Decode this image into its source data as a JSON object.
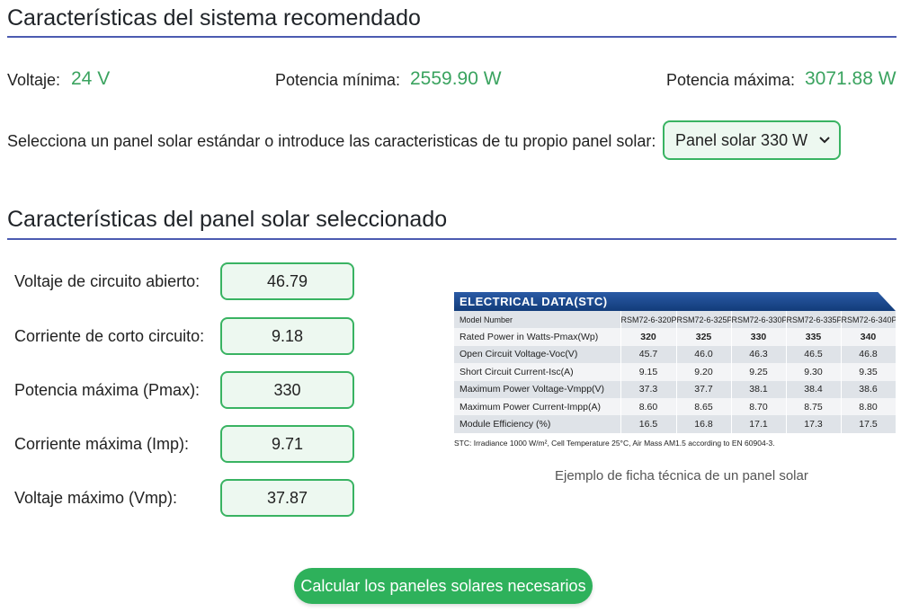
{
  "recommended": {
    "title": "Características del sistema recomendado",
    "voltage_label": "Voltaje:",
    "voltage_value": "24 V",
    "pmin_label": "Potencia mínima:",
    "pmin_value": "2559.90 W",
    "pmax_label": "Potencia máxima:",
    "pmax_value": "3071.88 W"
  },
  "panel_select": {
    "prompt": "Selecciona un panel solar estándar o introduce las caracteristicas de tu propio panel solar:",
    "selected": "Panel solar 330 W"
  },
  "selected_panel": {
    "title": "Características del panel solar seleccionado",
    "fields": [
      {
        "label": "Voltaje de circuito abierto:",
        "value": "46.79"
      },
      {
        "label": "Corriente de corto circuito:",
        "value": "9.18"
      },
      {
        "label": "Potencia máxima (Pmax):",
        "value": "330"
      },
      {
        "label": "Corriente máxima (Imp):",
        "value": "9.71"
      },
      {
        "label": "Voltaje máximo (Vmp):",
        "value": "37.87"
      }
    ]
  },
  "datasheet": {
    "header": "ELECTRICAL DATA(STC)",
    "rows": [
      [
        "Model Number",
        "RSM72-6-320P",
        "RSM72-6-325P",
        "RSM72-6-330P",
        "RSM72-6-335P",
        "RSM72-6-340P"
      ],
      [
        "Rated Power in Watts-Pmax(Wp)",
        "320",
        "325",
        "330",
        "335",
        "340"
      ],
      [
        "Open Circuit Voltage-Voc(V)",
        "45.7",
        "46.0",
        "46.3",
        "46.5",
        "46.8"
      ],
      [
        "Short Circuit Current-Isc(A)",
        "9.15",
        "9.20",
        "9.25",
        "9.30",
        "9.35"
      ],
      [
        "Maximum Power Voltage-Vmpp(V)",
        "37.3",
        "37.7",
        "38.1",
        "38.4",
        "38.6"
      ],
      [
        "Maximum Power Current-Impp(A)",
        "8.60",
        "8.65",
        "8.70",
        "8.75",
        "8.80"
      ],
      [
        "Module Efficiency (%)",
        "16.5",
        "16.8",
        "17.1",
        "17.3",
        "17.5"
      ]
    ],
    "note": "STC: Irradiance 1000 W/m², Cell Temperature 25°C, Air Mass AM1.5 according to EN 60904-3.",
    "caption": "Ejemplo de ficha técnica de un panel solar"
  },
  "calc_button": "Calcular los paneles solares necesarios",
  "colors": {
    "accent": "#39b362",
    "value": "#3aa35f",
    "rule": "#4c5bb1",
    "button": "#2eb15b"
  }
}
